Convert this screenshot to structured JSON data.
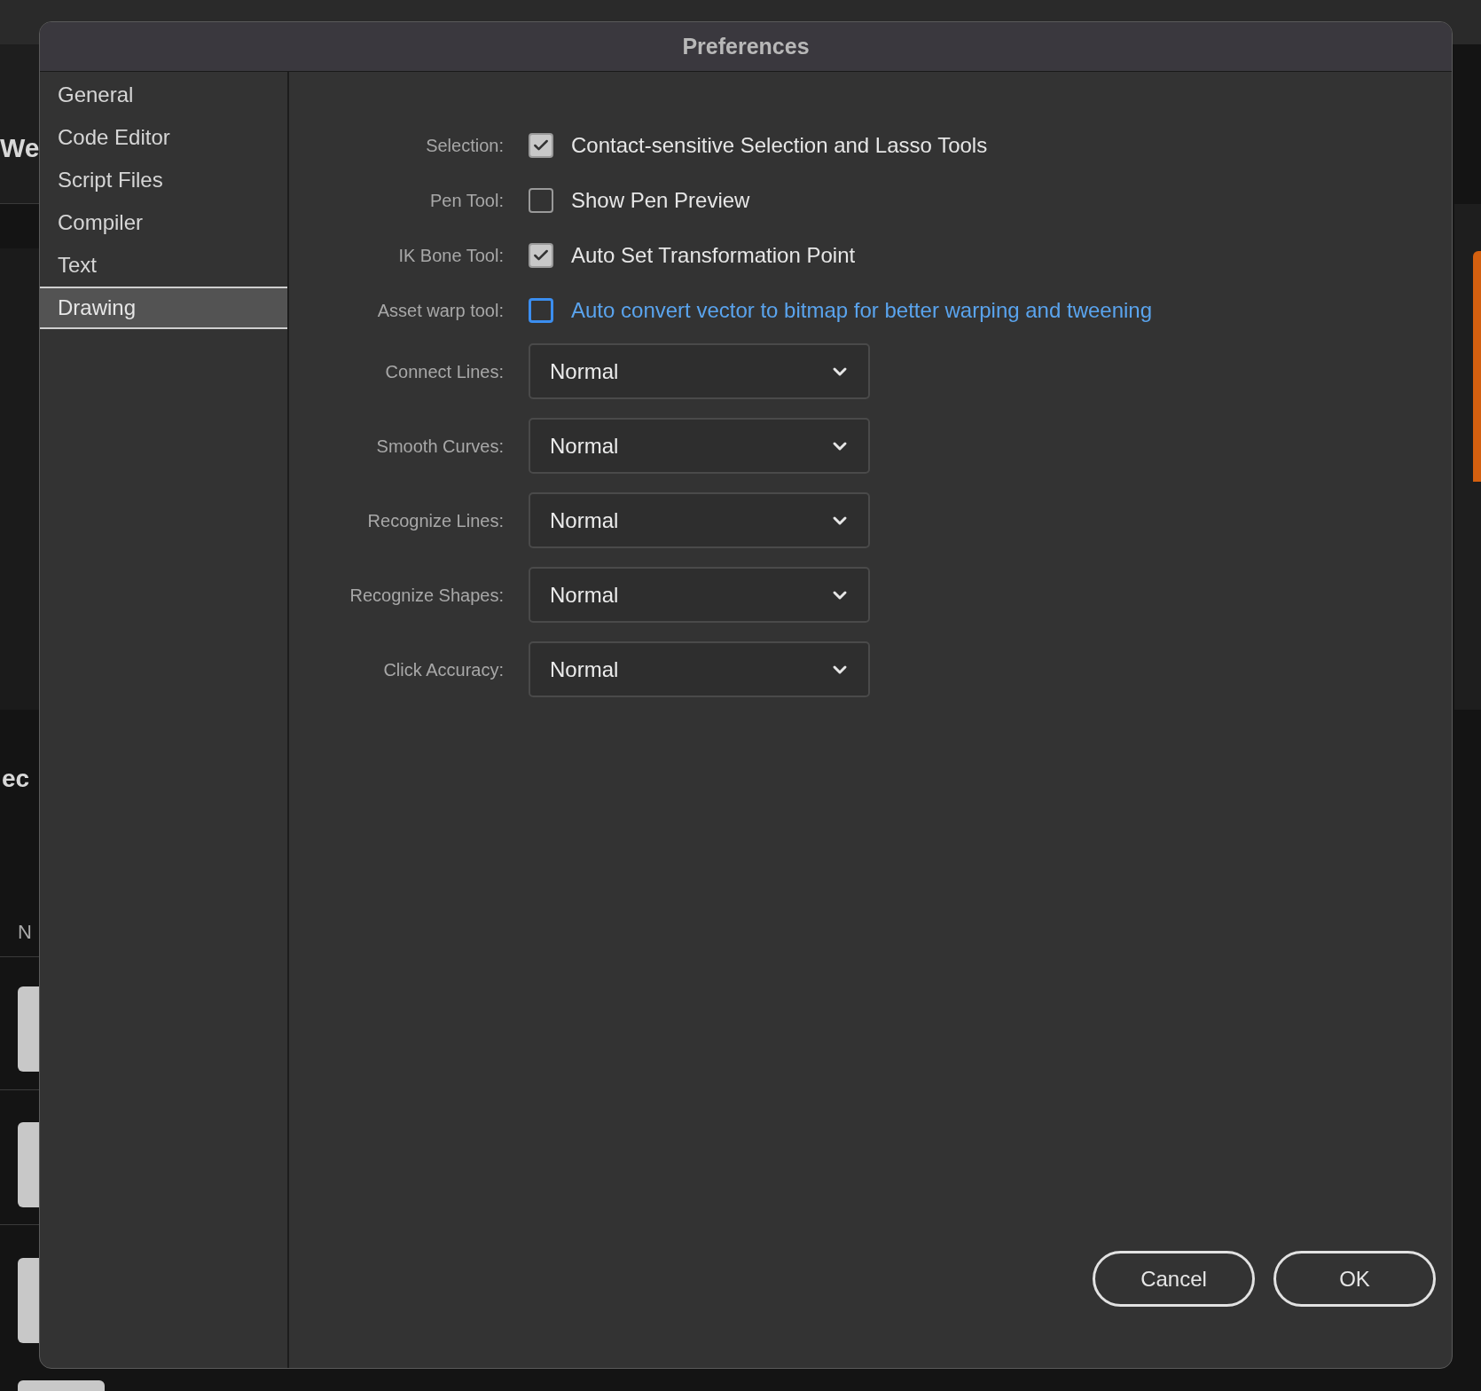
{
  "background": {
    "heading": "We",
    "section": "ec",
    "column": "N"
  },
  "window": {
    "title": "Preferences"
  },
  "sidebar": {
    "items": [
      {
        "label": "General",
        "selected": false
      },
      {
        "label": "Code Editor",
        "selected": false
      },
      {
        "label": "Script Files",
        "selected": false
      },
      {
        "label": "Compiler",
        "selected": false
      },
      {
        "label": "Text",
        "selected": false
      },
      {
        "label": "Drawing",
        "selected": true
      }
    ]
  },
  "options": [
    {
      "label": "Selection:",
      "text": "Contact-sensitive Selection and Lasso Tools",
      "checked": true,
      "focused": false
    },
    {
      "label": "Pen Tool:",
      "text": "Show Pen Preview",
      "checked": false,
      "focused": false
    },
    {
      "label": "IK Bone Tool:",
      "text": "Auto Set Transformation Point",
      "checked": true,
      "focused": false
    },
    {
      "label": "Asset warp tool:",
      "text": "Auto convert vector to bitmap for better warping and tweening",
      "checked": false,
      "focused": true
    }
  ],
  "dropdowns": [
    {
      "label": "Connect Lines:",
      "value": "Normal"
    },
    {
      "label": "Smooth Curves:",
      "value": "Normal"
    },
    {
      "label": "Recognize Lines:",
      "value": "Normal"
    },
    {
      "label": "Recognize Shapes:",
      "value": "Normal"
    },
    {
      "label": "Click Accuracy:",
      "value": "Normal"
    }
  ],
  "buttons": [
    "Cancel",
    "OK"
  ]
}
